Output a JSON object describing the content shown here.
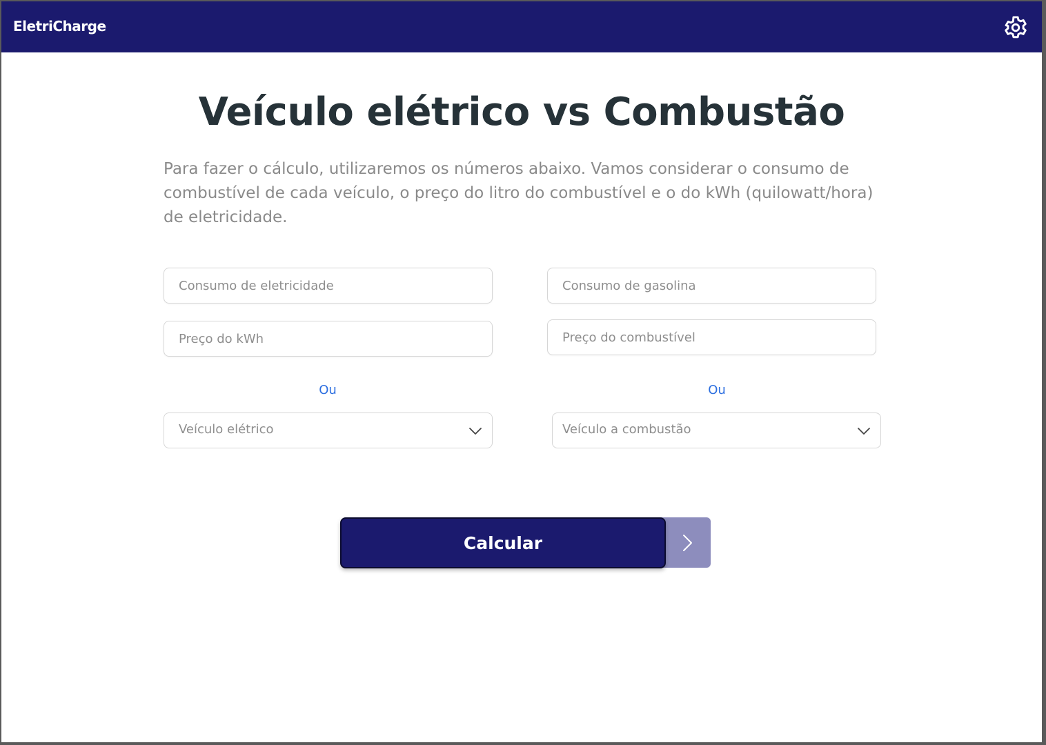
{
  "app": {
    "logo": "EletriCharge",
    "settings_icon": "gear-icon"
  },
  "page": {
    "title": "Veículo elétrico vs Combustão",
    "description": "Para fazer o cálculo, utilizaremos os números abaixo. Vamos considerar o consumo de combustível de cada veículo, o preço do litro do combustível e o do kWh (quilowatt/hora) de eletricidade."
  },
  "electric": {
    "consumption_placeholder": "Consumo de eletricidade",
    "consumption_value": "",
    "price_placeholder": "Preço do kWh",
    "price_value": "",
    "or_label": "Ou",
    "vehicle_select": "Veículo elétrico"
  },
  "combustion": {
    "consumption_placeholder": "Consumo de gasolina",
    "consumption_value": "",
    "price_placeholder": "Preço do combustível",
    "price_value": "",
    "or_label": "Ou",
    "vehicle_select": "Veículo a combustão"
  },
  "actions": {
    "calculate_label": "Calcular"
  },
  "colors": {
    "header_bg": "#1b1a6e",
    "title_text": "#263238",
    "link_blue": "#2d6fe0",
    "next_button_bg": "#8d8dbd"
  }
}
